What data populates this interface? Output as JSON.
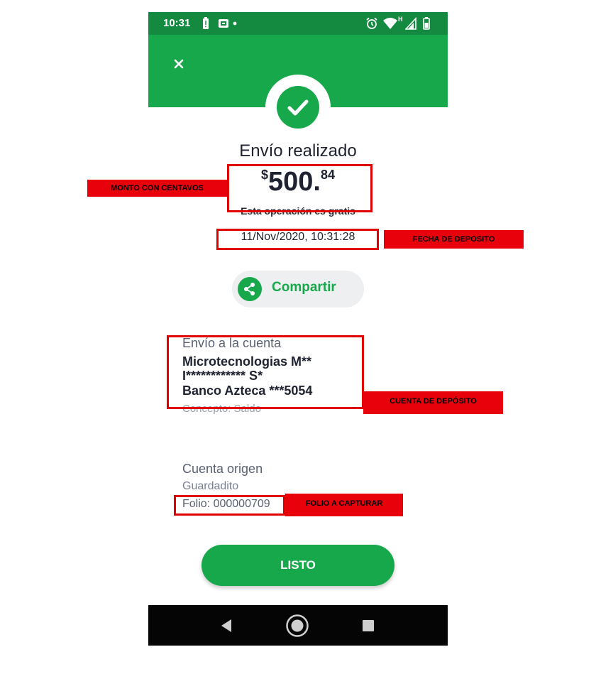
{
  "status_bar": {
    "time": "10:31",
    "left_icons": [
      "battery-alert-icon",
      "notification-icon",
      "dot-icon"
    ],
    "right_icons": [
      "alarm-icon",
      "wifi-icon",
      "signal-icon",
      "battery-icon"
    ],
    "network_label": "H"
  },
  "header": {
    "close_icon": "close-icon",
    "success_icon": "check-icon",
    "background_color": "#18a84c"
  },
  "receipt": {
    "title": "Envío realizado",
    "amount_currency": "$",
    "amount_integer": "500",
    "amount_dot": ".",
    "amount_cents": "84",
    "free_note": "Esta operación es gratis",
    "datetime": "11/Nov/2020, 10:31:28"
  },
  "share_button": {
    "label": "Compartir",
    "icon": "share-icon"
  },
  "destination": {
    "title": "Envío a la cuenta",
    "name_line1": "Microtecnologias M**",
    "name_line2": "I************ S*",
    "bank": "Banco Azteca ***5054",
    "concept": "Concepto: Saldo"
  },
  "origin": {
    "title": "Cuenta origen",
    "account": "Guardadito",
    "folio": "Folio: 000000709"
  },
  "done_button": {
    "label": "LISTO"
  },
  "nav_bar": {
    "icons": [
      "back-icon",
      "home-icon",
      "recents-icon"
    ]
  },
  "annotations": {
    "amount": "MONTO CON CENTAVOS",
    "date": "FECHA DE DEPOSITO",
    "account": "CUENTA DE DEPÓSITO",
    "folio": "FOLIO A CAPTURAR"
  },
  "colors": {
    "brand_green": "#18a84c",
    "status_green": "#138a3f",
    "annotation_red": "#e8000b"
  }
}
